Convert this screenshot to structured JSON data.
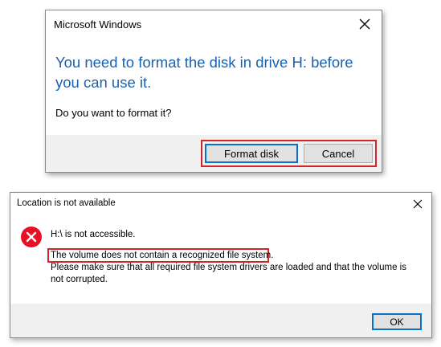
{
  "format_dialog": {
    "title": "Microsoft Windows",
    "message": "You need to format the disk in drive H: before you can use it.",
    "question": "Do you want to format it?",
    "format_button": "Format disk",
    "cancel_button": "Cancel",
    "close_icon": "close-icon",
    "highlight_color": "#d2252b",
    "accent_color": "#1a62b0"
  },
  "location_dialog": {
    "title": "Location is not available",
    "error_icon": "error-icon",
    "line1": "H:\\ is not accessible.",
    "line2": "The volume does not contain a recognized file system.",
    "line3": "Please make sure that all required file system drivers are loaded and that the volume is not corrupted.",
    "ok_button": "OK",
    "close_icon": "close-icon",
    "error_color": "#e81123"
  }
}
